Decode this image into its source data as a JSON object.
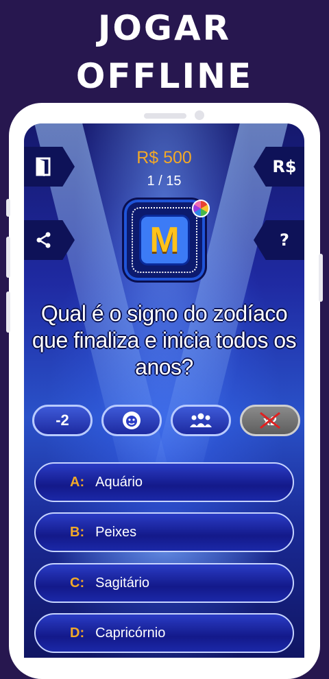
{
  "promo": {
    "line1": "JOGAR",
    "line2": "OFFLINE"
  },
  "game": {
    "prize": "R$ 500",
    "progress": "1 / 15",
    "logo_letter": "M",
    "money_button": "R$",
    "help_button": "?",
    "question": "Qual é o signo do zodíaco que finaliza e inicia todos os anos?"
  },
  "lifelines": [
    {
      "label": "-2",
      "icon": "minus-two"
    },
    {
      "label": "",
      "icon": "einstein-face-icon"
    },
    {
      "label": "",
      "icon": "audience-icon"
    },
    {
      "label": "",
      "icon": "skip-x2-icon",
      "used": true
    }
  ],
  "answers": [
    {
      "letter": "A:",
      "text": "Aquário"
    },
    {
      "letter": "B:",
      "text": "Peixes"
    },
    {
      "letter": "C:",
      "text": "Sagitário"
    },
    {
      "letter": "D:",
      "text": "Capricórnio"
    }
  ],
  "colors": {
    "accent": "#f2a928",
    "background": "#27174f",
    "answer_border": "#c7d4ff"
  }
}
